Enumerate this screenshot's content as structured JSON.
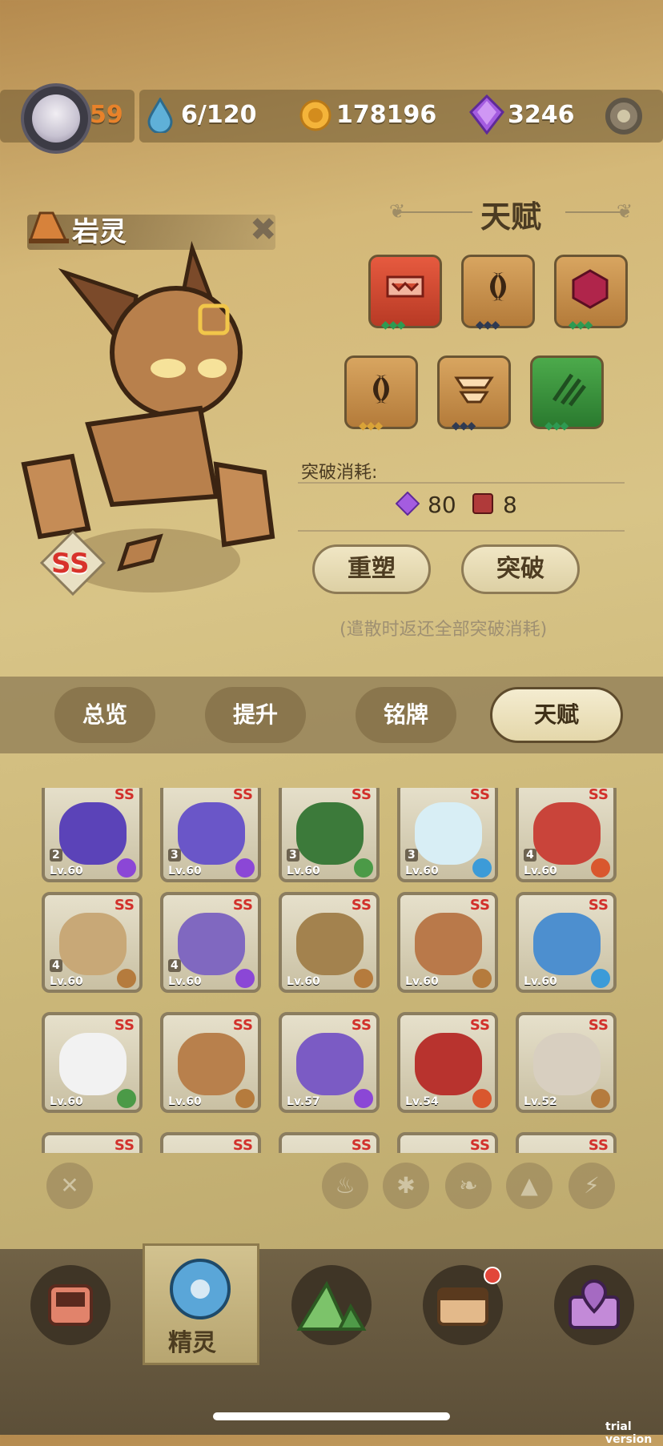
{
  "topbar": {
    "level": "59",
    "energy": "6/120",
    "coins": "178196",
    "gems": "3246"
  },
  "hero": {
    "name": "岩灵",
    "rank": "SS"
  },
  "talent": {
    "title": "天赋",
    "breakthrough_cost_label": "突破消耗:",
    "cost_gems": "80",
    "cost_books": "8",
    "reshape_label": "重塑",
    "breakthrough_label": "突破",
    "hint": "(遣散时返还全部突破消耗)"
  },
  "tabs": [
    {
      "label": "总览"
    },
    {
      "label": "提升"
    },
    {
      "label": "铭牌"
    },
    {
      "label": "天赋"
    }
  ],
  "cards": [
    {
      "star": "2",
      "lv": "Lv.60",
      "rank": "SS",
      "element": "lightning"
    },
    {
      "star": "3",
      "lv": "Lv.60",
      "rank": "SS",
      "element": "lightning"
    },
    {
      "star": "3",
      "lv": "Lv.60",
      "rank": "SS",
      "element": "leaf"
    },
    {
      "star": "3",
      "lv": "Lv.60",
      "rank": "SS",
      "element": "ice"
    },
    {
      "star": "4",
      "lv": "Lv.60",
      "rank": "SS",
      "element": "fire"
    },
    {
      "star": "4",
      "lv": "Lv.60",
      "rank": "SS",
      "element": "earth"
    },
    {
      "star": "4",
      "lv": "Lv.60",
      "rank": "SS",
      "element": "lightning"
    },
    {
      "star": "",
      "lv": "Lv.60",
      "rank": "SS",
      "element": "earth"
    },
    {
      "star": "",
      "lv": "Lv.60",
      "rank": "SS",
      "element": "earth"
    },
    {
      "star": "",
      "lv": "Lv.60",
      "rank": "SS",
      "element": "ice"
    },
    {
      "star": "",
      "lv": "Lv.60",
      "rank": "SS",
      "element": "leaf"
    },
    {
      "star": "",
      "lv": "Lv.60",
      "rank": "SS",
      "element": "earth"
    },
    {
      "star": "",
      "lv": "Lv.57",
      "rank": "SS",
      "element": "lightning"
    },
    {
      "star": "",
      "lv": "Lv.54",
      "rank": "SS",
      "element": "fire"
    },
    {
      "star": "",
      "lv": "Lv.52",
      "rank": "SS",
      "element": "earth"
    },
    {
      "star": "",
      "lv": "",
      "rank": "SS",
      "element": ""
    },
    {
      "star": "",
      "lv": "",
      "rank": "SS",
      "element": ""
    },
    {
      "star": "",
      "lv": "",
      "rank": "SS",
      "element": ""
    },
    {
      "star": "",
      "lv": "",
      "rank": "SS",
      "element": ""
    },
    {
      "star": "",
      "lv": "",
      "rank": "SS",
      "element": ""
    }
  ],
  "nav": {
    "spirit_label": "精灵"
  },
  "watermark": "trial version",
  "colors": {
    "fire": "#d9572e",
    "ice": "#3c9bd8",
    "leaf": "#4b9a47",
    "earth": "#b57b3d",
    "lightning": "#8b47d6"
  }
}
